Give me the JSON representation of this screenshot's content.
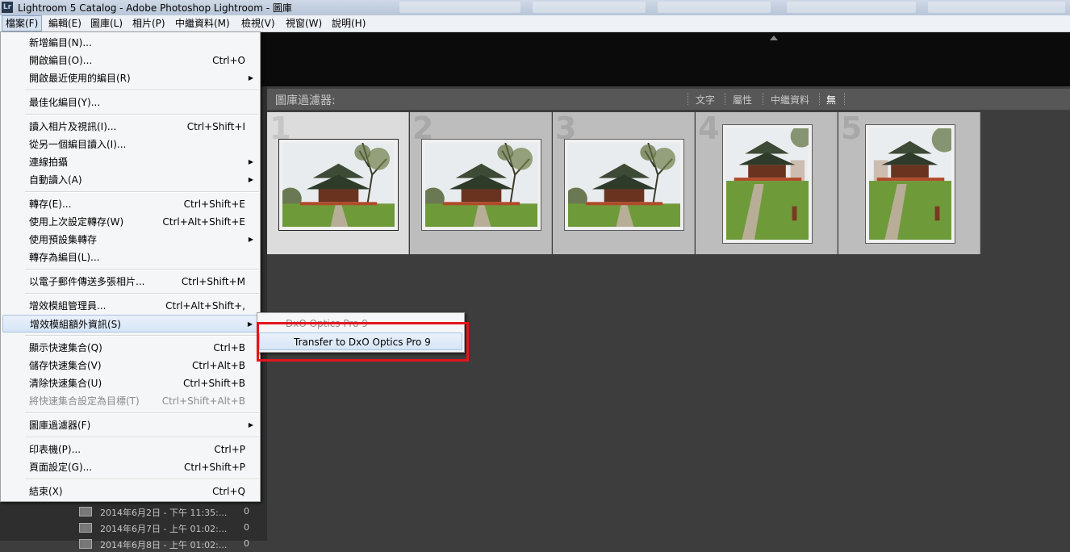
{
  "window": {
    "app_icon": "Lr",
    "title": "Lightroom 5 Catalog - Adobe Photoshop Lightroom - 圖庫"
  },
  "menubar": [
    {
      "label": "檔案(F)",
      "active": true
    },
    {
      "label": "編輯(E)"
    },
    {
      "label": "圖庫(L)"
    },
    {
      "label": "相片(P)"
    },
    {
      "label": "中繼資料(M)"
    },
    {
      "label": "檢視(V)"
    },
    {
      "label": "視窗(W)"
    },
    {
      "label": "說明(H)"
    }
  ],
  "file_menu": [
    {
      "label": "新增編目(N)...",
      "shortcut": ""
    },
    {
      "label": "開啟編目(O)...",
      "shortcut": "Ctrl+O"
    },
    {
      "label": "開啟最近使用的編目(R)",
      "submenu": true
    },
    {
      "label": "最佳化編目(Y)..."
    },
    {
      "label": "讀入相片及視訊(I)...",
      "shortcut": "Ctrl+Shift+I"
    },
    {
      "label": "從另一個編目讀入(I)..."
    },
    {
      "label": "連線拍攝",
      "submenu": true
    },
    {
      "label": "自動讀入(A)",
      "submenu": true
    },
    {
      "label": "轉存(E)...",
      "shortcut": "Ctrl+Shift+E"
    },
    {
      "label": "使用上次設定轉存(W)",
      "shortcut": "Ctrl+Alt+Shift+E"
    },
    {
      "label": "使用預設集轉存",
      "submenu": true
    },
    {
      "label": "轉存為編目(L)..."
    },
    {
      "label": "以電子郵件傳送多張相片...",
      "shortcut": "Ctrl+Shift+M"
    },
    {
      "label": "增效模組管理員...",
      "shortcut": "Ctrl+Alt+Shift+,"
    },
    {
      "label": "增效模組額外資訊(S)",
      "submenu": true,
      "highlighted": true
    },
    {
      "label": "顯示快速集合(Q)",
      "shortcut": "Ctrl+B"
    },
    {
      "label": "儲存快速集合(V)",
      "shortcut": "Ctrl+Alt+B"
    },
    {
      "label": "清除快速集合(U)",
      "shortcut": "Ctrl+Shift+B"
    },
    {
      "label": "將快速集合設定為目標(T)",
      "shortcut": "Ctrl+Shift+Alt+B",
      "disabled": true
    },
    {
      "label": "圖庫過濾器(F)",
      "submenu": true
    },
    {
      "label": "印表機(P)...",
      "shortcut": "Ctrl+P"
    },
    {
      "label": "頁面設定(G)...",
      "shortcut": "Ctrl+Shift+P"
    },
    {
      "label": "結束(X)",
      "shortcut": "Ctrl+Q"
    }
  ],
  "submenu": {
    "header": "DxO Optics Pro 9",
    "item": "Transfer to DxO Optics Pro 9"
  },
  "library_filter": {
    "label": "圖庫過濾器:",
    "options": [
      "文字",
      "屬性",
      "中繼資料",
      "無"
    ],
    "active": "無"
  },
  "grid": [
    {
      "index": "1",
      "selected": true
    },
    {
      "index": "2"
    },
    {
      "index": "3"
    },
    {
      "index": "4"
    },
    {
      "index": "5"
    }
  ],
  "left_panel": [
    {
      "label": "2014年6月2日 - 下午 11:35:...",
      "count": "0"
    },
    {
      "label": "2014年6月7日 - 上午 01:02:...",
      "count": "0"
    },
    {
      "label": "2014年6月8日 - 上午 01:02:...",
      "count": "0"
    }
  ],
  "colors": {
    "highlight_box": "#e3151d",
    "menu_bg": "#f5f6f7",
    "grid_bg": "#3d3d3d"
  }
}
